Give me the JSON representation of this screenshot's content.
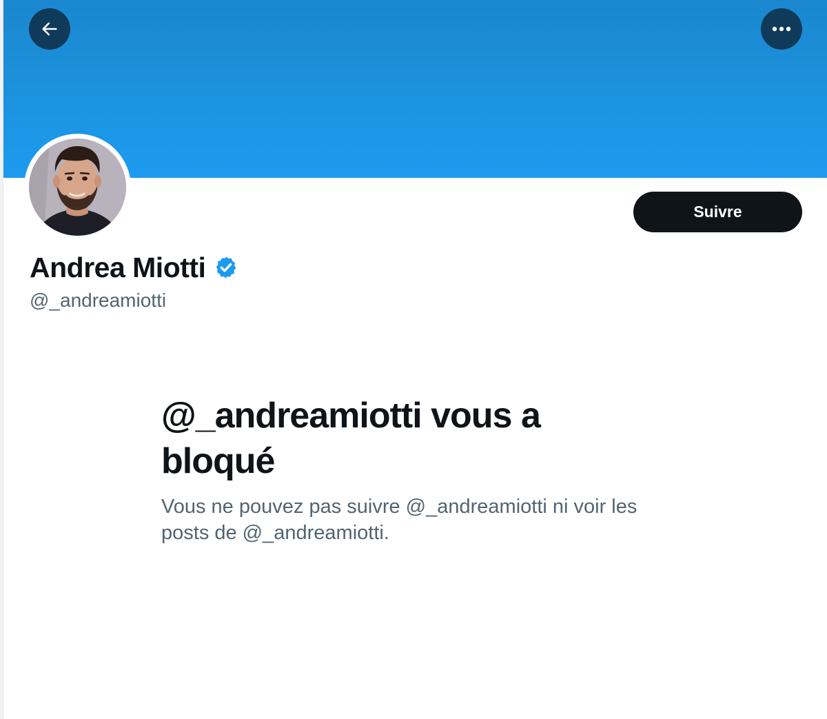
{
  "header": {
    "back_icon": "arrow-left-icon",
    "more_icon": "more-horizontal-icon",
    "banner_color": "#1d9bf0"
  },
  "profile": {
    "display_name": "Andrea Miotti",
    "verified_icon": "verified-badge-icon",
    "verified_color": "#1d9bf0",
    "handle": "@_andreamiotti",
    "follow_label": "Suivre"
  },
  "blocked_notice": {
    "title": "@_andreamiotti vous a bloqué",
    "description": "Vous ne pouvez pas suivre @_andreamiotti ni voir les posts de @_andreamiotti."
  },
  "colors": {
    "primary_text": "#0f1419",
    "secondary_text": "#536471",
    "button_bg": "#0f1419",
    "button_text": "#ffffff"
  }
}
